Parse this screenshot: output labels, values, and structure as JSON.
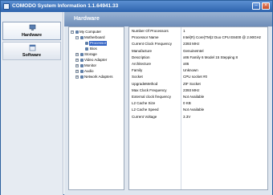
{
  "window": {
    "title": "COMODO System Information 1.1.64941.33",
    "minimize_glyph": "–",
    "close_glyph": "×"
  },
  "sidebar": {
    "items": [
      {
        "label": "Hardware",
        "icon": "hardware-icon",
        "active": true
      },
      {
        "label": "Software",
        "icon": "software-icon",
        "active": false
      }
    ]
  },
  "header": {
    "title": "Hardware"
  },
  "tree": {
    "items": [
      {
        "label": "My Computer",
        "expander": "−"
      },
      {
        "label": "Motherboard",
        "expander": "−"
      },
      {
        "label": "Processor",
        "selected": true
      },
      {
        "label": "Bios"
      },
      {
        "label": "Storage",
        "expander": "+"
      },
      {
        "label": "Video Adapter",
        "expander": "+"
      },
      {
        "label": "Monitor",
        "expander": "+"
      },
      {
        "label": "Audio",
        "expander": "+"
      },
      {
        "label": "Network Adapters",
        "expander": "+"
      }
    ]
  },
  "properties": [
    {
      "name": "Number Of Processors",
      "value": "1"
    },
    {
      "name": "Processor Name",
      "value": "Intel(R) Core(TM)2 Duo CPU     E8400  @ 2.90GHz"
    },
    {
      "name": "Current Clock Frequency",
      "value": "2393 MHz"
    },
    {
      "name": "Manufacture",
      "value": "GenuineIntel"
    },
    {
      "name": "Description",
      "value": "x86 Family 6 Model 15 Stepping 8"
    },
    {
      "name": "Architecture",
      "value": "x86"
    },
    {
      "name": "Family",
      "value": "Unknown"
    },
    {
      "name": "Socket",
      "value": "CPU socket #0"
    },
    {
      "name": "UpgradeMethod",
      "value": "ZIF Socket"
    },
    {
      "name": "Max Clock Frequency",
      "value": "2393 MHz"
    },
    {
      "name": "External clock frequency",
      "value": "Not Available"
    },
    {
      "name": "L2 Cache Size",
      "value": "0 KB"
    },
    {
      "name": "L2 Cache Speed",
      "value": "Not Available"
    },
    {
      "name": "Current Voltage",
      "value": "3.3V"
    }
  ]
}
